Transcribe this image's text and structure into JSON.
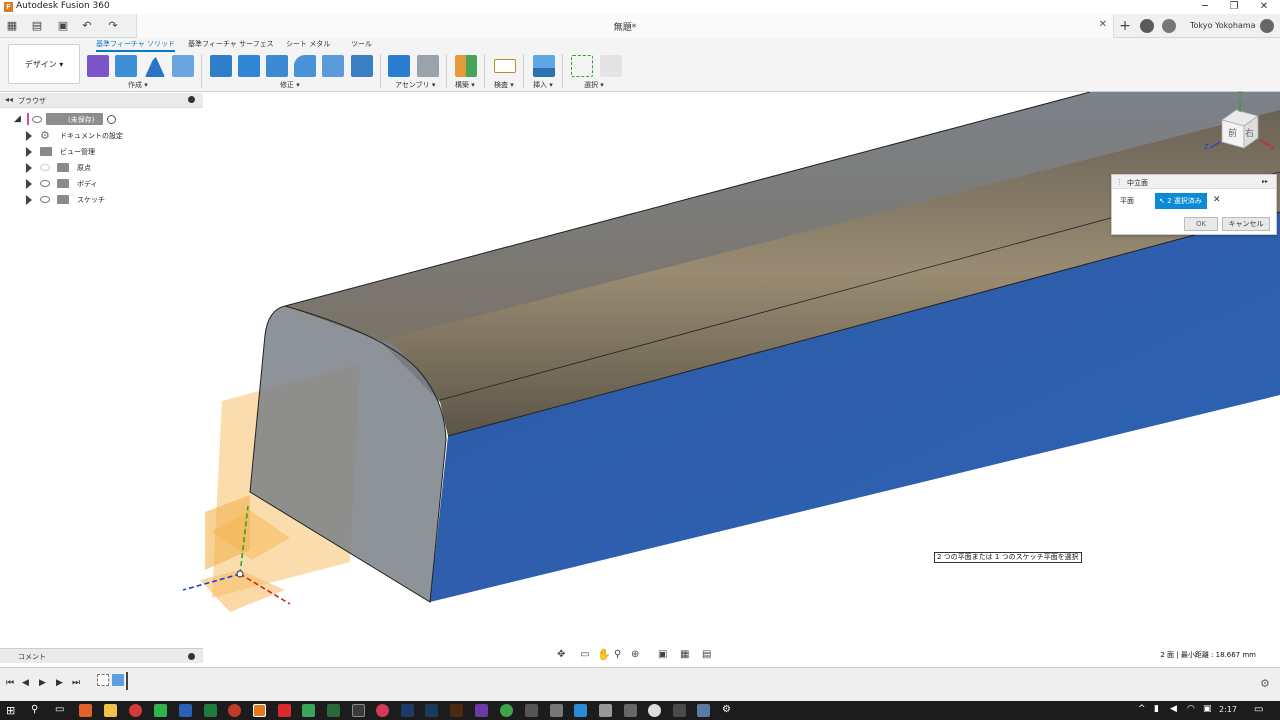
{
  "window": {
    "title": "Autodesk Fusion 360",
    "minimize": "─",
    "restore": "❐",
    "close": "✕"
  },
  "document": {
    "tab_title": "無題*",
    "close": "✕"
  },
  "user": {
    "name": "Tokyo Yokohama"
  },
  "workspace": {
    "label": "デザイン ▾"
  },
  "toolbar": {
    "tabs": [
      "基準フィーチャ ソリッド",
      "基準フィーチャ サーフェス",
      "シート メタル",
      "ツール"
    ],
    "groups": [
      "作成 ▾",
      "修正 ▾",
      "アセンブリ ▾",
      "構築 ▾",
      "検査 ▾",
      "挿入 ▾",
      "選択 ▾"
    ]
  },
  "browser": {
    "title": "ブラウザ",
    "root": "(未保存)",
    "items": [
      "ドキュメントの設定",
      "ビュー管理",
      "原点",
      "ボディ",
      "スケッチ"
    ]
  },
  "dialog": {
    "title": "中立面",
    "field_label": "平面",
    "selection": "2 選択済み",
    "clear": "✕",
    "ok": "OK",
    "cancel": "キャンセル",
    "expand": "▸▸"
  },
  "viewcube": {
    "front": "前",
    "right": "右",
    "axis_x": "X",
    "axis_y": "Y",
    "axis_z": "Z"
  },
  "hint": "2 つの平面または 1 つのスケッチ平面を選択",
  "comments": {
    "label": "コメント"
  },
  "status": "2 面 | 最小距離 : 18.667 mm",
  "timeline": {
    "buttons": [
      "⏮",
      "◀",
      "▶",
      "▶",
      "⏭"
    ]
  },
  "taskbar": {
    "time": "2:17"
  },
  "colors": {
    "accent": "#0b8bd6",
    "body_blue": "#2f5fae",
    "body_gray": "#6d7379",
    "plane_orange": "#f7c06a"
  }
}
